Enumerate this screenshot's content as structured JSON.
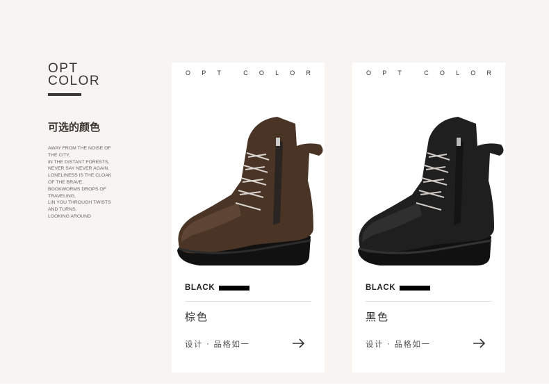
{
  "left": {
    "title_line1": "OPT",
    "title_line2": "COLOR",
    "cn_title": "可选的颜色",
    "poem": [
      "AWAY FROM THE NOISE OF",
      "THE CITY,",
      "IN THE DISTANT FORESTS,",
      "NEVER SAY NEVER AGAIN.",
      "LONELINESS IS THE CLOAK",
      "OF THE BRAVE,",
      "BOOKWORMS DROPS OF",
      "TRAVELING,",
      "LIN YOU THROUGH TWISTS",
      "AND TURNS,",
      "LOOKING AROUND"
    ]
  },
  "cards": [
    {
      "header": [
        "O",
        "P",
        "T",
        "",
        "C",
        "O",
        "L",
        "O",
        "R"
      ],
      "label": "BLACK",
      "color_name": "棕色",
      "design": "设计 · 品格如一",
      "shoe_color": "#4a3426",
      "shoe_highlight": "#6d5141"
    },
    {
      "header": [
        "O",
        "P",
        "T",
        "",
        "C",
        "O",
        "L",
        "O",
        "R"
      ],
      "label": "BLACK",
      "color_name": "黑色",
      "design": "设计 · 品格如一",
      "shoe_color": "#1f1f1f",
      "shoe_highlight": "#3a3a3a"
    }
  ],
  "icons": {
    "arrow": "arrow-right-icon",
    "product": "boot-icon"
  }
}
